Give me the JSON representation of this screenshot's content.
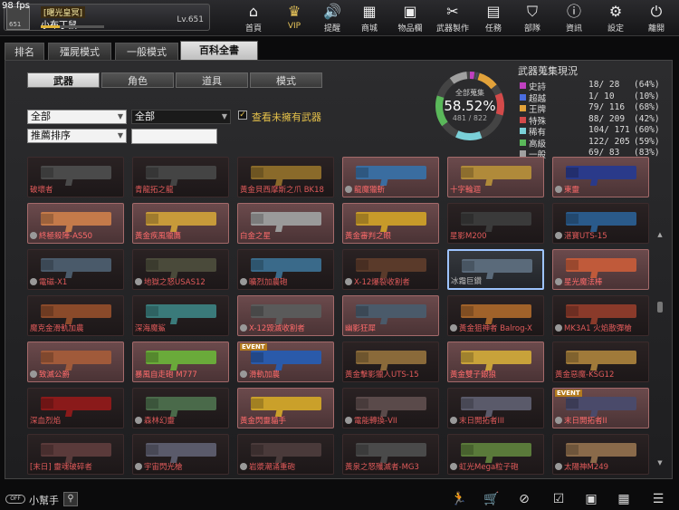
{
  "fps": "98 fps",
  "profile": {
    "guild": "[曙光皇冥]",
    "name": "小布丁鼠",
    "level": "Lv.651",
    "rank_code": "651",
    "exp_progress": 0.3
  },
  "nav": [
    {
      "id": "home",
      "label": "首頁",
      "icon": "home-icon",
      "glyph": "⌂"
    },
    {
      "id": "vip",
      "label": "VIP",
      "icon": "crown-icon",
      "glyph": "♛"
    },
    {
      "id": "remind",
      "label": "提醒",
      "icon": "speaker-icon",
      "glyph": "🔊"
    },
    {
      "id": "shop",
      "label": "商城",
      "icon": "store-icon",
      "glyph": "▦"
    },
    {
      "id": "inventory",
      "label": "物品欄",
      "icon": "briefcase-icon",
      "glyph": "▣"
    },
    {
      "id": "craft",
      "label": "武器製作",
      "icon": "weapon-craft-icon",
      "glyph": "✂"
    },
    {
      "id": "mission",
      "label": "任務",
      "icon": "ticket-icon",
      "glyph": "▤"
    },
    {
      "id": "unit",
      "label": "部隊",
      "icon": "shield-icon",
      "glyph": "⛉"
    },
    {
      "id": "info",
      "label": "資訊",
      "icon": "info-icon",
      "glyph": "ⓘ"
    },
    {
      "id": "settings",
      "label": "設定",
      "icon": "gear-icon",
      "glyph": "⚙"
    },
    {
      "id": "exit",
      "label": "離開",
      "icon": "power-icon",
      "glyph": "⏻"
    }
  ],
  "tabs": [
    {
      "label": "排名",
      "active": false
    },
    {
      "label": "殭屍模式",
      "active": false
    },
    {
      "label": "一般模式",
      "active": false
    },
    {
      "label": "百科全書",
      "active": true
    }
  ],
  "subtabs": [
    {
      "label": "武器",
      "active": true
    },
    {
      "label": "角色",
      "active": false
    },
    {
      "label": "道具",
      "active": false
    },
    {
      "label": "模式",
      "active": false
    }
  ],
  "filters": {
    "category": "全部",
    "subcategory": "全部",
    "sort": "推薦排序",
    "search_value": "",
    "show_unowned_label": "查看未擁有武器",
    "show_unowned": true
  },
  "collection": {
    "center_title": "全部蒐集",
    "percent": "58.52%",
    "count": "481 / 822",
    "title": "武器蒐集現況",
    "stats": [
      {
        "name": "史詩",
        "owned": 18,
        "total": 28,
        "pct": "(64%)",
        "color": "#c040c0"
      },
      {
        "name": "超越",
        "owned": 1,
        "total": 10,
        "pct": "(10%)",
        "color": "#4a6de0"
      },
      {
        "name": "王牌",
        "owned": 79,
        "total": 116,
        "pct": "(68%)",
        "color": "#e2a23a"
      },
      {
        "name": "特殊",
        "owned": 88,
        "total": 209,
        "pct": "(42%)",
        "color": "#d34a4a"
      },
      {
        "name": "稀有",
        "owned": 104,
        "total": 171,
        "pct": "(60%)",
        "color": "#7ad0d8"
      },
      {
        "name": "高級",
        "owned": 122,
        "total": 205,
        "pct": "(59%)",
        "color": "#5ab85a"
      },
      {
        "name": "一般",
        "owned": 69,
        "total": 83,
        "pct": "(83%)",
        "color": "#a0a0a0"
      }
    ]
  },
  "weapons": [
    {
      "name": "破壞者",
      "state": "dim",
      "color": "#4a4a4a"
    },
    {
      "name": "青龍拓之龍",
      "state": "dim",
      "color": "#444"
    },
    {
      "name": "黃金貝西摩斯之爪 BK18",
      "state": "dim",
      "color": "#8a6a2a"
    },
    {
      "name": "龍魔獵斬",
      "state": "owned",
      "gear": true,
      "color": "#3a6da0"
    },
    {
      "name": "十字輪迴",
      "state": "owned",
      "color": "#b08a3a"
    },
    {
      "name": "東靈",
      "state": "owned",
      "gear": true,
      "color": "#2a3a8a"
    },
    {
      "name": "終極殺陣-AS50",
      "state": "owned",
      "gear": true,
      "color": "#c47a4a"
    },
    {
      "name": "黃金疾風獵鷹",
      "state": "owned",
      "color": "#c79a3a"
    },
    {
      "name": "白金之星",
      "state": "owned",
      "color": "#9a9a9a"
    },
    {
      "name": "黃金審判之眼",
      "state": "owned",
      "color": "#c79a2a"
    },
    {
      "name": "星影M200",
      "state": "dim",
      "color": "#3a3a3a"
    },
    {
      "name": "湛寶UTS-15",
      "state": "dim",
      "gear": true,
      "color": "#2a5a8a"
    },
    {
      "name": "電磁-X1",
      "state": "dim",
      "gear": true,
      "color": "#4a5a6a"
    },
    {
      "name": "地獄之怒USAS12",
      "state": "dim",
      "gear": true,
      "color": "#4a4a3a"
    },
    {
      "name": "曠烈加農砲",
      "state": "dim",
      "gear": true,
      "color": "#3a6a8a"
    },
    {
      "name": "X-12爆裂收割者",
      "state": "dim",
      "gear": true,
      "color": "#5a3a2a"
    },
    {
      "name": "冰霜巨鑽",
      "state": "sel",
      "color": "#5a6a7a"
    },
    {
      "name": "星光魔法棒",
      "state": "owned",
      "gear": true,
      "color": "#c05a3a"
    },
    {
      "name": "魔克金滑軌加農",
      "state": "dim",
      "color": "#8a4a2a"
    },
    {
      "name": "深海魔鯊",
      "state": "dim",
      "color": "#3a7a7a"
    },
    {
      "name": "X-12毀滅收割者",
      "state": "owned",
      "gear": true,
      "color": "#5a5a5a"
    },
    {
      "name": "幽影狂犀",
      "state": "owned",
      "color": "#4a5a6a"
    },
    {
      "name": "黃金狙神者 Balrog-X",
      "state": "dim",
      "gear": true,
      "color": "#a0622a"
    },
    {
      "name": "MK3A1 火焰散彈槍",
      "state": "dim",
      "gear": true,
      "color": "#8a3a2a"
    },
    {
      "name": "致滅公爵",
      "state": "owned",
      "gear": true,
      "color": "#a05a3a"
    },
    {
      "name": "暴風自走砲 M777",
      "state": "owned",
      "color": "#6aaa3a"
    },
    {
      "name": "滑軌加農",
      "state": "owned",
      "gear": true,
      "event": true,
      "color": "#2a5aaa"
    },
    {
      "name": "黃金擊影獵人UTS-15",
      "state": "dim",
      "color": "#8a6a3a"
    },
    {
      "name": "黃金雙子銀狼",
      "state": "owned",
      "color": "#c8a23a"
    },
    {
      "name": "黃金惡魔-KSG12",
      "state": "dim",
      "color": "#a07a3a"
    },
    {
      "name": "深血烈焰",
      "state": "dim",
      "color": "#8a1a1a"
    },
    {
      "name": "森林幻靈",
      "state": "dim",
      "gear": true,
      "color": "#4a6a4a"
    },
    {
      "name": "黃金閃靈貓手",
      "state": "owned",
      "color": "#caa02a"
    },
    {
      "name": "電能轉換-VII",
      "state": "dim",
      "gear": true,
      "color": "#5a4a4a"
    },
    {
      "name": "末日開拓者III",
      "state": "dim",
      "gear": true,
      "color": "#5a5a6a"
    },
    {
      "name": "末日開拓者II",
      "state": "owned",
      "gear": true,
      "event": true,
      "color": "#4a4a6a"
    },
    {
      "name": "[末日] 靈魂破碎者",
      "state": "dim",
      "color": "#5a3a3a"
    },
    {
      "name": "宇宙閃光槍",
      "state": "dim",
      "gear": true,
      "color": "#5a5a6a"
    },
    {
      "name": "岩漿潮涌重砲",
      "state": "dim",
      "gear": true,
      "color": "#4a3a3a"
    },
    {
      "name": "黃泉之怒殲滅者-MG3",
      "state": "dim",
      "color": "#4a4a4a"
    },
    {
      "name": "虹光Mega粒子砲",
      "state": "dim",
      "gear": true,
      "color": "#5a7a3a"
    },
    {
      "name": "太陽神M249",
      "state": "dim",
      "gear": true,
      "color": "#8a6a4a"
    }
  ],
  "bottom": {
    "helper_label": "小幫手",
    "icons": [
      {
        "name": "runner-icon",
        "glyph": "🏃"
      },
      {
        "name": "cart-icon",
        "glyph": "🛒"
      },
      {
        "name": "compass-icon",
        "glyph": "⊘"
      },
      {
        "name": "checklist-icon",
        "glyph": "☑"
      },
      {
        "name": "book-icon",
        "glyph": "▣"
      },
      {
        "name": "calendar-icon",
        "glyph": "▦"
      },
      {
        "name": "menu-icon",
        "glyph": "☰"
      }
    ]
  }
}
